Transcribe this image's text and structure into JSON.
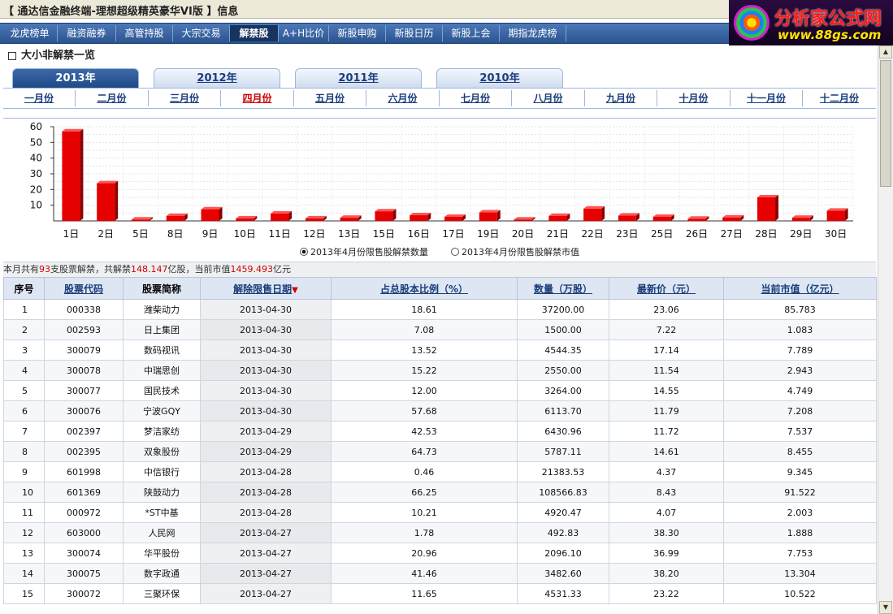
{
  "window": {
    "title": "【 通达信金融终端-理想超级精英豪华VI版 】信息"
  },
  "logo": {
    "line1": "分析家公式网",
    "line2": "www.88gs.com"
  },
  "nav": {
    "items": [
      "龙虎榜单",
      "融资融券",
      "高管持股",
      "大宗交易",
      "解禁股",
      "A+H比价",
      "新股申购",
      "新股日历",
      "新股上会",
      "期指龙虎榜"
    ],
    "active": "解禁股"
  },
  "section": {
    "title": "大小非解禁一览"
  },
  "years": {
    "items": [
      "2013年",
      "2012年",
      "2011年",
      "2010年"
    ],
    "active": "2013年"
  },
  "months": {
    "items": [
      "一月份",
      "二月份",
      "三月份",
      "四月份",
      "五月份",
      "六月份",
      "七月份",
      "八月份",
      "九月份",
      "十月份",
      "十一月份",
      "十二月份"
    ],
    "active": "四月份"
  },
  "chart_data": {
    "type": "bar",
    "categories": [
      "1日",
      "2日",
      "5日",
      "8日",
      "9日",
      "10日",
      "11日",
      "12日",
      "13日",
      "15日",
      "16日",
      "17日",
      "19日",
      "20日",
      "21日",
      "22日",
      "23日",
      "25日",
      "26日",
      "27日",
      "28日",
      "29日",
      "30日"
    ],
    "values": [
      57,
      24,
      0.9,
      3.2,
      7.4,
      1.6,
      4.7,
      1.6,
      2.0,
      6.1,
      3.6,
      2.6,
      5.4,
      0.9,
      3.2,
      7.8,
      3.4,
      2.6,
      1.4,
      2.2,
      15,
      2.0,
      6.5
    ],
    "ylim": [
      0,
      60
    ],
    "yticks": [
      10,
      20,
      30,
      40,
      50,
      60
    ],
    "bar_color": "#e60000",
    "grid": true,
    "legend": [
      {
        "label": "2013年4月份限售股解禁数量",
        "selected": true
      },
      {
        "label": "2013年4月份限售股解禁市值",
        "selected": false
      }
    ]
  },
  "summary": {
    "p1": "本月共有",
    "count": "93",
    "p2": "支股票解禁，共解禁",
    "total_shares": "148.147",
    "p3": "亿股，当前市值",
    "market_value": "1459.493",
    "p4": "亿元"
  },
  "table": {
    "headers": [
      "序号",
      "股票代码",
      "股票简称",
      "解除限售日期",
      "占总股本比例（%）",
      "数量（万股）",
      "最新价（元）",
      "当前市值（亿元）"
    ],
    "sort_indicator": "▼",
    "rows": [
      [
        "1",
        "000338",
        "潍柴动力",
        "2013-04-30",
        "18.61",
        "37200.00",
        "23.06",
        "85.783"
      ],
      [
        "2",
        "002593",
        "日上集团",
        "2013-04-30",
        "7.08",
        "1500.00",
        "7.22",
        "1.083"
      ],
      [
        "3",
        "300079",
        "数码视讯",
        "2013-04-30",
        "13.52",
        "4544.35",
        "17.14",
        "7.789"
      ],
      [
        "4",
        "300078",
        "中瑞思创",
        "2013-04-30",
        "15.22",
        "2550.00",
        "11.54",
        "2.943"
      ],
      [
        "5",
        "300077",
        "国民技术",
        "2013-04-30",
        "12.00",
        "3264.00",
        "14.55",
        "4.749"
      ],
      [
        "6",
        "300076",
        "宁波GQY",
        "2013-04-30",
        "57.68",
        "6113.70",
        "11.79",
        "7.208"
      ],
      [
        "7",
        "002397",
        "梦洁家纺",
        "2013-04-29",
        "42.53",
        "6430.96",
        "11.72",
        "7.537"
      ],
      [
        "8",
        "002395",
        "双象股份",
        "2013-04-29",
        "64.73",
        "5787.11",
        "14.61",
        "8.455"
      ],
      [
        "9",
        "601998",
        "中信银行",
        "2013-04-28",
        "0.46",
        "21383.53",
        "4.37",
        "9.345"
      ],
      [
        "10",
        "601369",
        "陕鼓动力",
        "2013-04-28",
        "66.25",
        "108566.83",
        "8.43",
        "91.522"
      ],
      [
        "11",
        "000972",
        "*ST中基",
        "2013-04-28",
        "10.21",
        "4920.47",
        "4.07",
        "2.003"
      ],
      [
        "12",
        "603000",
        "人民网",
        "2013-04-27",
        "1.78",
        "492.83",
        "38.30",
        "1.888"
      ],
      [
        "13",
        "300074",
        "华平股份",
        "2013-04-27",
        "20.96",
        "2096.10",
        "36.99",
        "7.753"
      ],
      [
        "14",
        "300075",
        "数字政通",
        "2013-04-27",
        "41.46",
        "3482.60",
        "38.20",
        "13.304"
      ],
      [
        "15",
        "300072",
        "三聚环保",
        "2013-04-27",
        "11.65",
        "4531.33",
        "23.22",
        "10.522"
      ]
    ]
  }
}
